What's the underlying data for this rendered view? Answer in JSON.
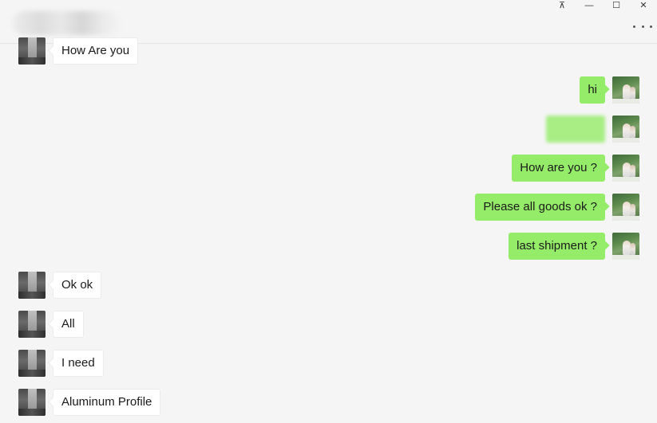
{
  "window": {
    "title": "",
    "controls": {
      "pin": "⊼",
      "minimize": "—",
      "maximize": "☐",
      "close": "✕"
    }
  },
  "colors": {
    "background": "#f5f5f5",
    "self_bubble": "#95ec69",
    "other_bubble": "#ffffff"
  },
  "messages": [
    {
      "sender": "other",
      "text": "How Are you"
    },
    {
      "sender": "self",
      "text": "hi"
    },
    {
      "sender": "self",
      "text": ""
    },
    {
      "sender": "self",
      "text": "How are you ?"
    },
    {
      "sender": "self",
      "text": "Please all goods ok ?"
    },
    {
      "sender": "self",
      "text": "last shipment ?"
    },
    {
      "sender": "other",
      "text": "Ok ok"
    },
    {
      "sender": "other",
      "text": "All"
    },
    {
      "sender": "other",
      "text": "I need"
    },
    {
      "sender": "other",
      "text": "Aluminum Profile"
    }
  ]
}
